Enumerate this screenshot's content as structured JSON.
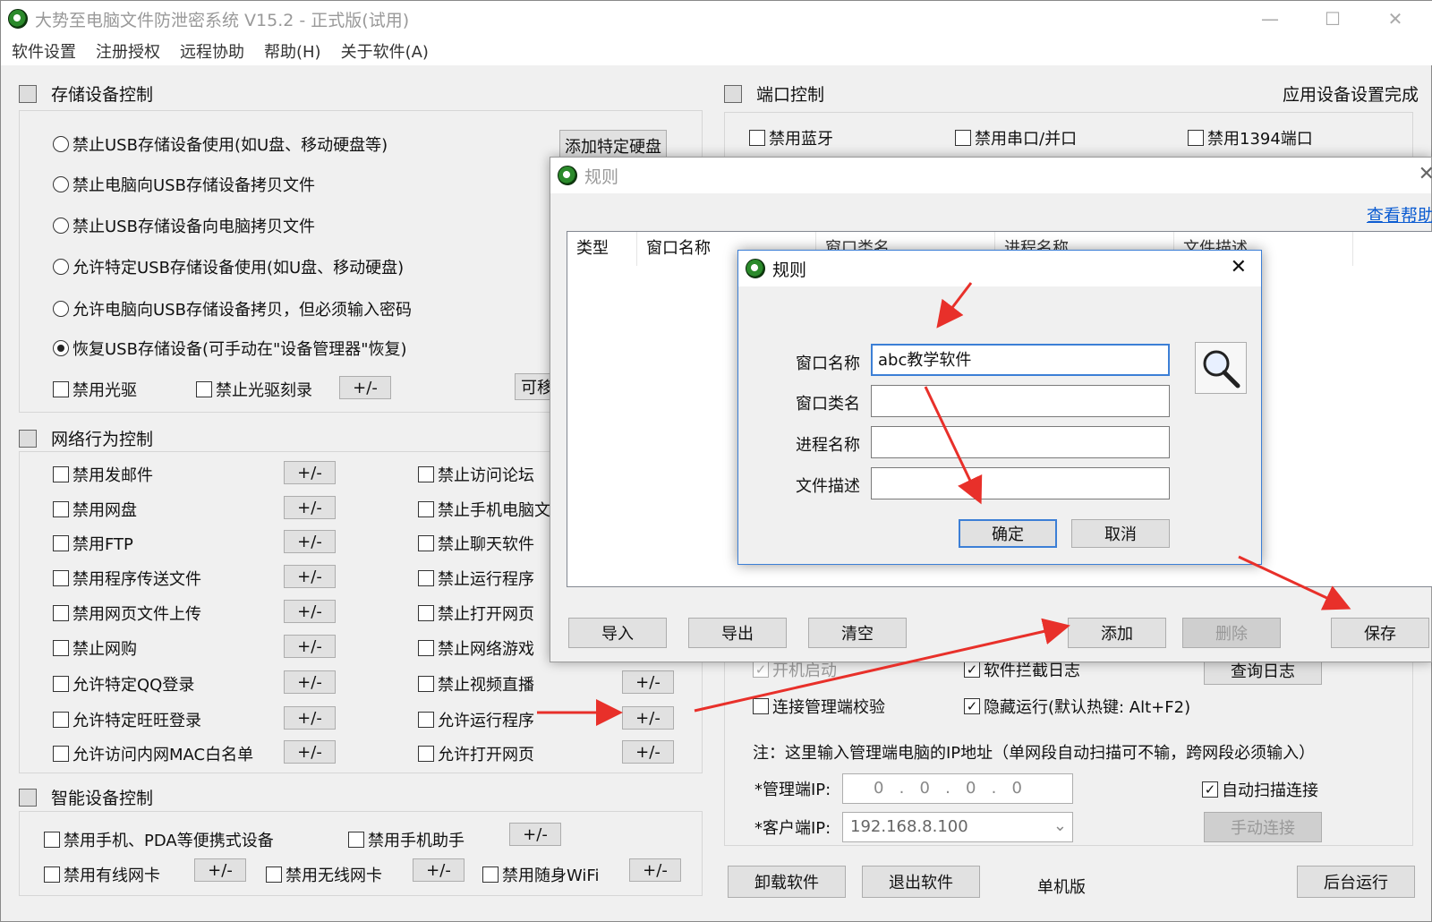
{
  "window": {
    "title": "大势至电脑文件防泄密系统 V15.2 - 正式版(试用)"
  },
  "menu": [
    "软件设置",
    "注册授权",
    "远程协助",
    "帮助(H)",
    "关于软件(A)"
  ],
  "storage": {
    "title": "存储设备控制",
    "radios": [
      "禁止USB存储设备使用(如U盘、移动硬盘等)",
      "禁止电脑向USB存储设备拷贝文件",
      "禁止USB存储设备向电脑拷贝文件",
      "允许特定USB存储设备使用(如U盘、移动硬盘)",
      "允许电脑向USB存储设备拷贝，但必须输入密码",
      "恢复USB存储设备(可手动在\"设备管理器\"恢复)"
    ],
    "selected_index": 5,
    "add_disk_button": "添加特定硬盘",
    "cd_disable": "禁用光驱",
    "cd_burn": "禁止光驱刻录",
    "plusminus": "+/-",
    "movable_button": "可移"
  },
  "network": {
    "title": "网络行为控制",
    "left": [
      "禁用发邮件",
      "禁用网盘",
      "禁用FTP",
      "禁用程序传送文件",
      "禁用网页文件上传",
      "禁止网购",
      "允许特定QQ登录",
      "允许特定旺旺登录",
      "允许访问内网MAC白名单"
    ],
    "right": [
      "禁止访问论坛",
      "禁止手机电脑文",
      "禁止聊天软件",
      "禁止运行程序",
      "禁止打开网页",
      "禁止网络游戏",
      "禁止视频直播",
      "允许运行程序",
      "允许打开网页"
    ]
  },
  "smart": {
    "title": "智能设备控制",
    "items": [
      "禁用手机、PDA等便携式设备",
      "禁用手机助手",
      "禁用有线网卡",
      "禁用无线网卡",
      "禁用随身WiFi"
    ]
  },
  "port": {
    "title": "端口控制",
    "status": "应用设备设置完成",
    "items": [
      "禁用蓝牙",
      "禁用串口/并口",
      "禁用1394端口"
    ]
  },
  "misc": {
    "autostart": "开机启动",
    "intercept_log": "软件拦截日志",
    "query_log": "查询日志",
    "conn_check": "连接管理端校验",
    "hidden_run": "隐藏运行(默认热键: Alt+F2)",
    "note": "注：这里输入管理端电脑的IP地址（单网段自动扫描可不输，跨网段必须输入）",
    "admin_ip_label": "*管理端IP:",
    "admin_ip": "0   .   0   .   0   .   0",
    "client_ip_label": "*客户端IP:",
    "client_ip": "192.168.8.100",
    "auto_scan": "自动扫描连接",
    "manual_connect": "手动连接"
  },
  "bottom": {
    "uninstall": "卸载软件",
    "exit": "退出软件",
    "edition": "单机版",
    "background": "后台运行"
  },
  "rule_dialog": {
    "title": "规则",
    "help_link": "查看帮助",
    "columns": [
      "类型",
      "窗口名称",
      "窗口类名",
      "进程名称",
      "文件描述"
    ],
    "buttons": {
      "import": "导入",
      "export": "导出",
      "clear": "清空",
      "add": "添加",
      "delete": "删除",
      "save": "保存"
    }
  },
  "rule_edit": {
    "title": "规则",
    "labels": [
      "窗口名称",
      "窗口类名",
      "进程名称",
      "文件描述"
    ],
    "window_name_value": "abc教学软件",
    "ok": "确定",
    "cancel": "取消"
  },
  "colors": {
    "accent": "#3c7fd6",
    "arrow": "#e8302a",
    "link": "#0a5bd1"
  }
}
